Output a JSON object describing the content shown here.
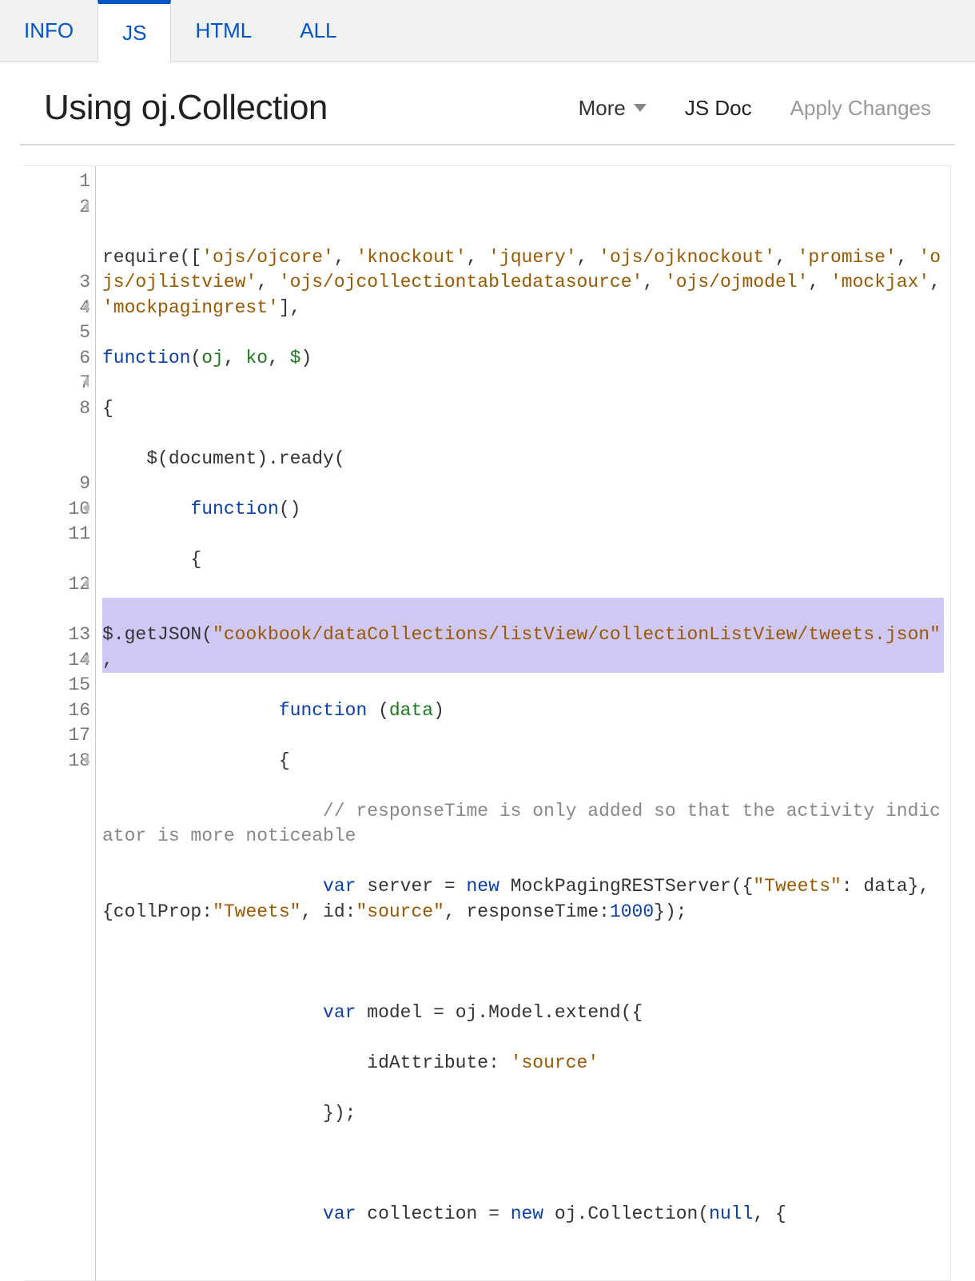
{
  "tabs": {
    "info": "INFO",
    "js": "JS",
    "html": "HTML",
    "all": "ALL",
    "active": "js"
  },
  "header": {
    "title": "Using oj.Collection",
    "more_label": "More",
    "jsdoc_label": "JS Doc",
    "apply_label": "Apply Changes"
  },
  "editor": {
    "gutter": [
      {
        "n": "1",
        "fold": false
      },
      {
        "n": "2",
        "fold": true
      },
      {
        "n": "3",
        "fold": false
      },
      {
        "n": "4",
        "fold": true
      },
      {
        "n": "5",
        "fold": false
      },
      {
        "n": "6",
        "fold": false
      },
      {
        "n": "7",
        "fold": true
      },
      {
        "n": "8",
        "fold": false
      },
      {
        "n": "9",
        "fold": false
      },
      {
        "n": "10",
        "fold": true
      },
      {
        "n": "11",
        "fold": false
      },
      {
        "n": "12",
        "fold": true
      },
      {
        "n": "13",
        "fold": false
      },
      {
        "n": "14",
        "fold": true
      },
      {
        "n": "15",
        "fold": false
      },
      {
        "n": "16",
        "fold": false
      },
      {
        "n": "17",
        "fold": false
      },
      {
        "n": "18",
        "fold": true
      }
    ],
    "code": {
      "l1": "",
      "l2_pre": "require([",
      "l2_s1": "'ojs/ojcore'",
      "l2_c1": ", ",
      "l2_s2": "'knockout'",
      "l2_c2": ", ",
      "l2_s3": "'jquery'",
      "l2_c3": ", ",
      "l2_s4": "'ojs/ojknockout'",
      "l2_c4": ", ",
      "l2_s5": "'promise'",
      "l2_c5": ", ",
      "l2_s6": "'ojs/ojlistview'",
      "l2_c6": ", ",
      "l2_s7": "'ojs/ojcollectiontabledatasource'",
      "l2_c7": ", ",
      "l2_s8": "'ojs/ojmodel'",
      "l2_c8": ", ",
      "l2_s9": "'mockjax'",
      "l2_c9": ", ",
      "l2_s10": "'mockpagingrest'",
      "l2_end": "],",
      "l3_kw": "function",
      "l3_open": "(",
      "l3_p1": "oj",
      "l3_c1": ", ",
      "l3_p2": "ko",
      "l3_c2": ", ",
      "l3_p3": "$",
      "l3_close": ")",
      "l4": "{",
      "l5_pre": "    $(document).ready(",
      "l6_pre": "        ",
      "l6_kw": "function",
      "l6_post": "()",
      "l7": "        {",
      "l8_pre": "$.getJSON(",
      "l8_str": "\"cookbook/dataCollections/listView/collectionListView/tweets.json\"",
      "l8_post": ",",
      "l9_pre": "                ",
      "l9_kw": "function",
      "l9_open": " (",
      "l9_p": "data",
      "l9_close": ")",
      "l10": "                {",
      "l11_pre": "                    ",
      "l11_comment": "// responseTime is only added so that the activity indicator is more noticeable",
      "l12_pre": "                    ",
      "l12_var": "var",
      "l12_sp1": " server = ",
      "l12_new": "new",
      "l12_sp2": " MockPagingRESTServer({",
      "l12_s1": "\"Tweets\"",
      "l12_c1": ": data}, {collProp:",
      "l12_s2": "\"Tweets\"",
      "l12_c2": ", id:",
      "l12_s3": "\"source\"",
      "l12_c3": ", responseTime:",
      "l12_num": "1000",
      "l12_end": "});",
      "l13": "",
      "l14_pre": "                    ",
      "l14_var": "var",
      "l14_rest": " model = oj.Model.extend({",
      "l15_pre": "                        idAttribute: ",
      "l15_str": "'source'",
      "l16": "                    });",
      "l17": "",
      "l18_pre": "                    ",
      "l18_var": "var",
      "l18_sp": " collection = ",
      "l18_new": "new",
      "l18_rest": " oj.Collection(",
      "l18_null": "null",
      "l18_end": ", {"
    }
  }
}
